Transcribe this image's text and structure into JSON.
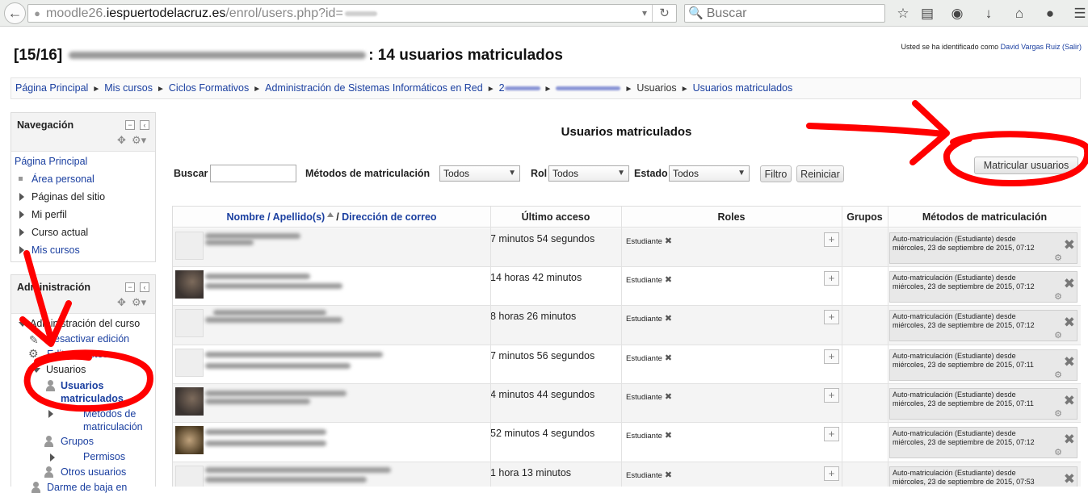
{
  "browser": {
    "url_prefix": "moodle26.",
    "url_host": "iespuertodelacruz.es",
    "url_path": "/enrol/users.php?id=",
    "search_placeholder": "Buscar"
  },
  "header": {
    "title_prefix": "[15/16]",
    "title_suffix": ": 14 usuarios matriculados",
    "login_prefix": "Usted se ha identificado como ",
    "login_user": "David Vargas Ruiz",
    "logout_label": "(Salir)"
  },
  "breadcrumb": {
    "items": [
      "Página Principal",
      "Mis cursos",
      "Ciclos Formativos",
      "Administración de Sistemas Informáticos en Red"
    ],
    "blurred_start": "2",
    "current_parent": "Usuarios",
    "current": "Usuarios matriculados",
    "separator": "►"
  },
  "navigation": {
    "title": "Navegación",
    "items": [
      "Página Principal",
      "Área personal",
      "Páginas del sitio",
      "Mi perfil",
      "Curso actual",
      "Mis cursos"
    ]
  },
  "administration": {
    "title": "Administración",
    "course_admin": "Administración del curso",
    "items": [
      "Desactivar edición",
      "Editar ajustes",
      "Usuarios",
      "Usuarios matriculados",
      "Métodos de matriculación",
      "Grupos",
      "Permisos",
      "Otros usuarios",
      "Darme de baja en"
    ]
  },
  "main": {
    "heading": "Usuarios matriculados",
    "enrol_button": "Matricular usuarios"
  },
  "filters": {
    "search_label": "Buscar",
    "methods_label": "Métodos de matriculación",
    "methods_value": "Todos",
    "role_label": "Rol",
    "role_value": "Todos",
    "status_label": "Estado",
    "status_value": "Todos",
    "filter_button": "Filtro",
    "reset_button": "Reiniciar"
  },
  "table": {
    "col_name": "Nombre / Apellido(s)",
    "col_email": "Dirección de correo",
    "col_access": "Último acceso",
    "col_roles": "Roles",
    "col_groups": "Grupos",
    "col_methods": "Métodos de matriculación",
    "rows": [
      {
        "access": "7 minutos 54 segundos",
        "role": "Estudiante",
        "method": "Auto-matriculación (Estudiante) desde miércoles, 23 de septiembre de 2015, 07:12",
        "avatar": "default"
      },
      {
        "access": "14 horas 42 minutos",
        "role": "Estudiante",
        "method": "Auto-matriculación (Estudiante) desde miércoles, 23 de septiembre de 2015, 07:12",
        "avatar": "photo"
      },
      {
        "access": "8 horas 26 minutos",
        "role": "Estudiante",
        "method": "Auto-matriculación (Estudiante) desde miércoles, 23 de septiembre de 2015, 07:12",
        "avatar": "default"
      },
      {
        "access": "7 minutos 56 segundos",
        "role": "Estudiante",
        "method": "Auto-matriculación (Estudiante) desde miércoles, 23 de septiembre de 2015, 07:11",
        "avatar": "default"
      },
      {
        "access": "4 minutos 44 segundos",
        "role": "Estudiante",
        "method": "Auto-matriculación (Estudiante) desde miércoles, 23 de septiembre de 2015, 07:11",
        "avatar": "photo"
      },
      {
        "access": "52 minutos 4 segundos",
        "role": "Estudiante",
        "method": "Auto-matriculación (Estudiante) desde miércoles, 23 de septiembre de 2015, 07:12",
        "avatar": "photo2"
      },
      {
        "access": "1 hora 13 minutos",
        "role": "Estudiante",
        "method": "Auto-matriculación (Estudiante) desde miércoles, 23 de septiembre de 2015, 07:53",
        "avatar": "default"
      }
    ]
  },
  "colors": {
    "link": "#1a3fa0",
    "annotation": "#ff0000"
  }
}
